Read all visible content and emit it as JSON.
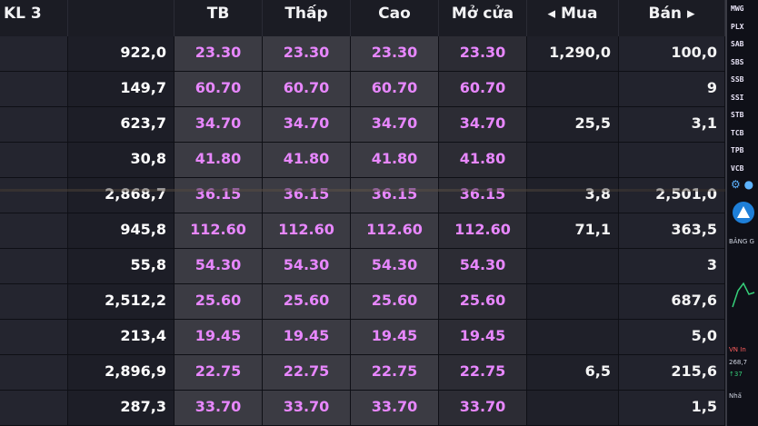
{
  "headers": {
    "kl": "KL 3",
    "tb": "TB",
    "thap": "Thấp",
    "cao": "Cao",
    "mo_cua": "Mở cửa",
    "mua": "◂ Mua",
    "ban": "Bán ▸"
  },
  "rows": [
    {
      "kl": "922,0",
      "tb": "23.30",
      "thap": "23.30",
      "cao": "23.30",
      "mo": "23.30",
      "mua": "1,290,0",
      "ban": "100,0"
    },
    {
      "kl": "149,7",
      "tb": "60.70",
      "thap": "60.70",
      "cao": "60.70",
      "mo": "60.70",
      "mua": "",
      "ban": "9"
    },
    {
      "kl": "623,7",
      "tb": "34.70",
      "thap": "34.70",
      "cao": "34.70",
      "mo": "34.70",
      "mua": "25,5",
      "ban": "3,1"
    },
    {
      "kl": "30,8",
      "tb": "41.80",
      "thap": "41.80",
      "cao": "41.80",
      "mo": "41.80",
      "mua": "",
      "ban": ""
    },
    {
      "kl": "2,868,7",
      "tb": "36.15",
      "thap": "36.15",
      "cao": "36.15",
      "mo": "36.15",
      "mua": "3,8",
      "ban": "2,501,0"
    },
    {
      "kl": "945,8",
      "tb": "112.60",
      "thap": "112.60",
      "cao": "112.60",
      "mo": "112.60",
      "mua": "71,1",
      "ban": "363,5"
    },
    {
      "kl": "55,8",
      "tb": "54.30",
      "thap": "54.30",
      "cao": "54.30",
      "mo": "54.30",
      "mua": "",
      "ban": "3"
    },
    {
      "kl": "2,512,2",
      "tb": "25.60",
      "thap": "25.60",
      "cao": "25.60",
      "mo": "25.60",
      "mua": "",
      "ban": "687,6"
    },
    {
      "kl": "213,4",
      "tb": "19.45",
      "thap": "19.45",
      "cao": "19.45",
      "mo": "19.45",
      "mua": "",
      "ban": "5,0"
    },
    {
      "kl": "2,896,9",
      "tb": "22.75",
      "thap": "22.75",
      "cao": "22.75",
      "mo": "22.75",
      "mua": "6,5",
      "ban": "215,6"
    },
    {
      "kl": "287,3",
      "tb": "33.70",
      "thap": "33.70",
      "cao": "33.70",
      "mo": "33.70",
      "mua": "",
      "ban": "1,5"
    }
  ],
  "sidebar": {
    "tickers": [
      "MWG",
      "PLX",
      "SAB",
      "SBS",
      "SSB",
      "SSI",
      "STB",
      "TCB",
      "TPB",
      "VCB"
    ],
    "text_1": "BẢNG G",
    "text_2": "VN In",
    "text_3": "268,7",
    "text_4": "↑37",
    "text_5": "Nhấ"
  },
  "colors": {
    "price": "#e887ff",
    "header_text": "#f2f2f4",
    "value_text": "#ffffff"
  }
}
